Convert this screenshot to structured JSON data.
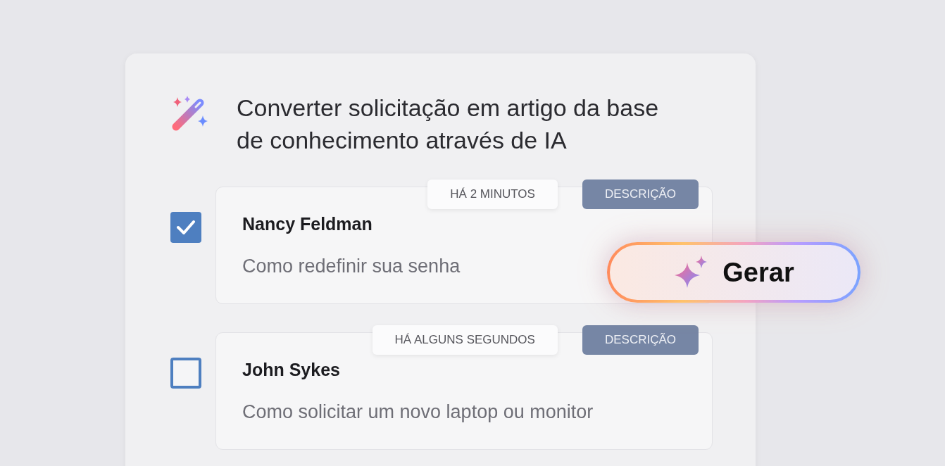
{
  "title": "Converter solicitação em artigo da base de conhecimento através de IA",
  "tickets": [
    {
      "checked": true,
      "time": "HÁ 2 MINUTOS",
      "type": "DESCRIÇÃO",
      "name": "Nancy Feldman",
      "subject": "Como redefinir sua senha"
    },
    {
      "checked": false,
      "time": "HÁ ALGUNS SEGUNDOS",
      "type": "DESCRIÇÃO",
      "name": "John Sykes",
      "subject": "Como solicitar um novo laptop ou monitor"
    }
  ],
  "generate_button": {
    "label": "Gerar"
  }
}
